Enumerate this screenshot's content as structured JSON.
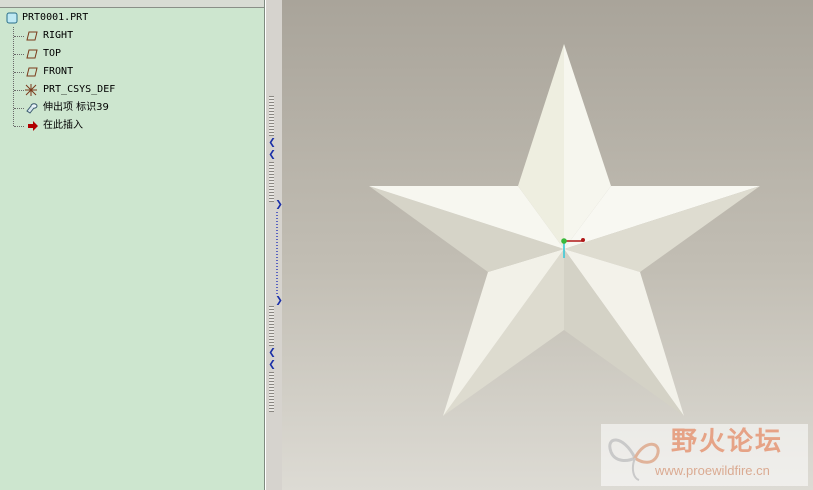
{
  "model_tree": {
    "root": "PRT0001.PRT",
    "items": [
      {
        "label": "RIGHT",
        "icon": "datum-plane-icon"
      },
      {
        "label": "TOP",
        "icon": "datum-plane-icon"
      },
      {
        "label": "FRONT",
        "icon": "datum-plane-icon"
      },
      {
        "label": "PRT_CSYS_DEF",
        "icon": "coordinate-system-icon"
      },
      {
        "label": "伸出项 标识39",
        "icon": "extrude-feature-icon"
      },
      {
        "label": "在此插入",
        "icon": "insert-here-arrow-icon"
      }
    ]
  },
  "colors": {
    "tree_bg": "#cde6cf",
    "viewport_top": "#a9a49a",
    "viewport_bottom": "#dddbd4",
    "star_light": "#f2f1e6",
    "star_shade": "#d6d4c8",
    "insert_arrow": "#b00000"
  },
  "watermark": {
    "title": "野火论坛",
    "url": "www.proewildfire.cn"
  }
}
